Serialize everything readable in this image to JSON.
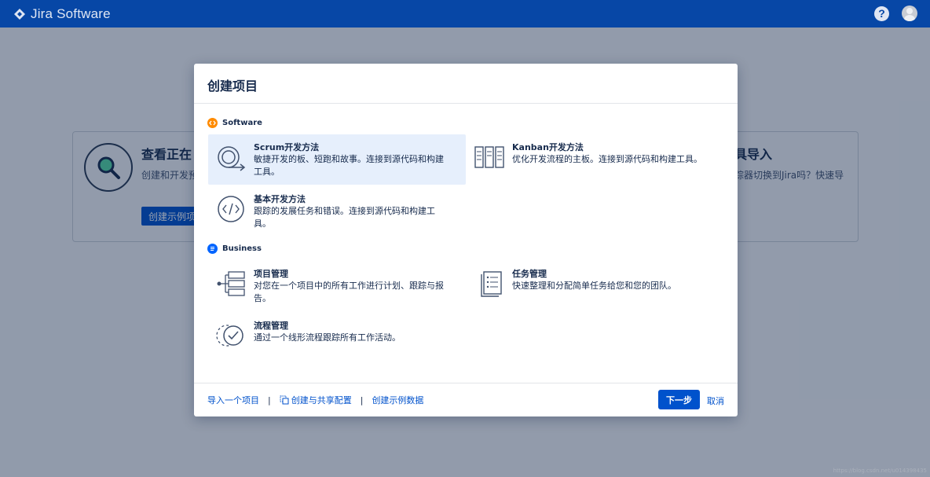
{
  "topbar": {
    "brand": "Jira Software",
    "help_icon": "question-circle-icon",
    "avatar_icon": "user-avatar-icon"
  },
  "background": {
    "left_card_title": "查看正在",
    "left_card_desc": "创建和开发预",
    "left_card_button": "创建示例项",
    "right_card_title": "具导入",
    "right_card_desc": "踪器切换到Jira吗？快速导"
  },
  "modal": {
    "title": "创建项目",
    "sections": {
      "software": {
        "label": "Software",
        "options": [
          {
            "title": "Scrum开发方法",
            "desc_line1": "敏捷开发的板、短跑和故事。连接到源代码和构建",
            "desc_line2": "工具。",
            "icon": "scrum-cycle-icon"
          },
          {
            "title": "Kanban开发方法",
            "desc_line1": "优化开发流程的主板。连接到源代码和构建工具。",
            "icon": "kanban-board-icon"
          },
          {
            "title": "基本开发方法",
            "desc_line1": "跟踪的发展任务和错误。连接到源代码和构建工",
            "desc_line2": "具。",
            "icon": "code-brackets-icon"
          }
        ]
      },
      "business": {
        "label": "Business",
        "options": [
          {
            "title": "项目管理",
            "desc_line1": "对您在一个项目中的所有工作进行计划、跟踪与报",
            "desc_line2": "告。",
            "icon": "project-stack-icon"
          },
          {
            "title": "任务管理",
            "desc_line1": "快速整理和分配简单任务给您和您的团队。",
            "icon": "task-list-icon"
          },
          {
            "title": "流程管理",
            "desc_line1": "通过一个线形流程跟踪所有工作活动。",
            "icon": "process-check-icon"
          }
        ]
      }
    },
    "footer": {
      "import_link": "导入一个项目",
      "share_config_link": "创建与共享配置",
      "sample_data_link": "创建示例数据",
      "separator": "|",
      "next_button": "下一步",
      "cancel_button": "取消"
    }
  },
  "watermark": "https://blog.csdn.net/u014398435"
}
